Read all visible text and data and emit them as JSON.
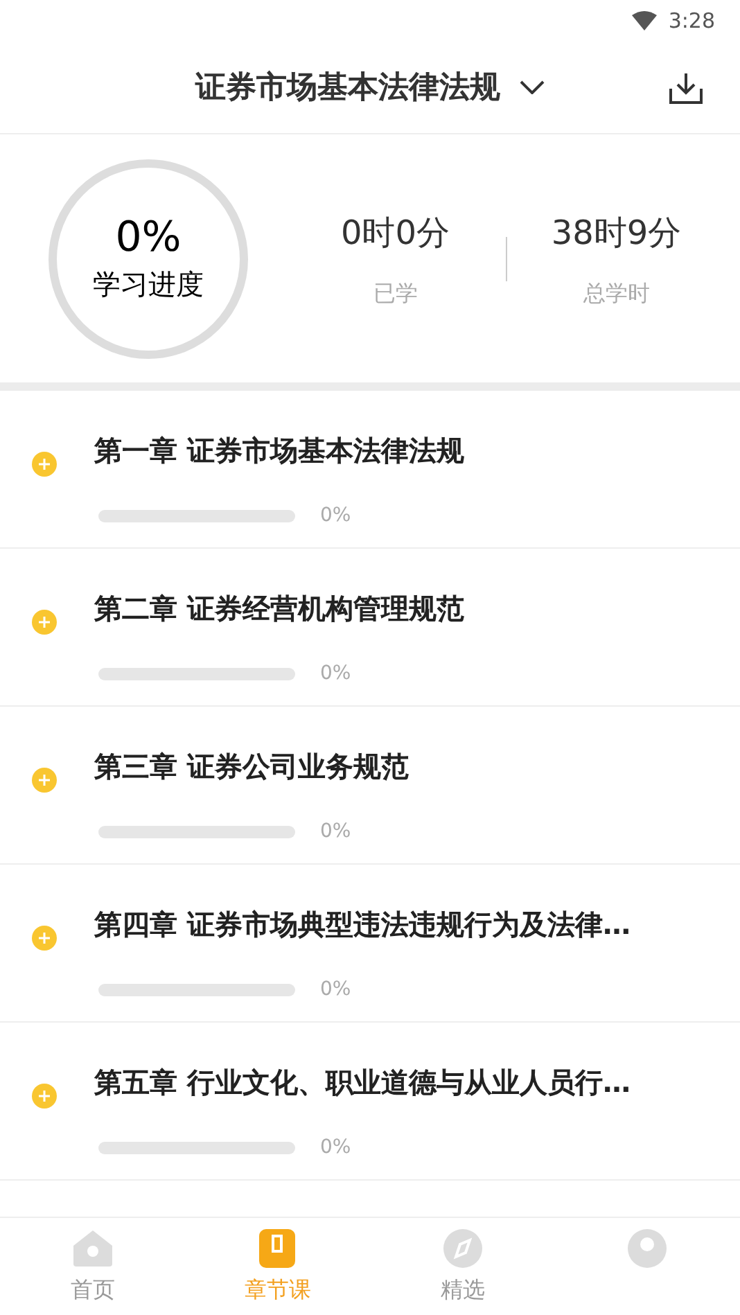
{
  "status_bar": {
    "time": "3:28"
  },
  "header": {
    "title": "证券市场基本法律法规"
  },
  "summary": {
    "progress": {
      "value": "0%",
      "label": "学习进度"
    },
    "stats": [
      {
        "value": "0时0分",
        "label": "已学"
      },
      {
        "value": "38时9分",
        "label": "总学时"
      }
    ]
  },
  "chapters": [
    {
      "title": "第一章 证券市场基本法律法规",
      "level": 0,
      "reading": "0%"
    },
    {
      "title": "第二章 证券经营机构管理规范",
      "level": 0,
      "reading": "0%"
    },
    {
      "title": "第三章 证券公司业务规范",
      "level": 0,
      "reading": "0%"
    },
    {
      "title": "第四章 证券市场典型违法违规行为及法律…",
      "level": 0,
      "reading": "0%"
    },
    {
      "title": "第五章 行业文化、职业道德与从业人员行…",
      "level": 0,
      "reading": "0%"
    }
  ],
  "tab_bar": [
    {
      "kind": "home",
      "label": "首页",
      "selected": false
    },
    {
      "kind": "book",
      "label": "章节课",
      "selected": true
    },
    {
      "kind": "compass",
      "label": "精选",
      "selected": false
    },
    {
      "kind": "profile",
      "selected": false
    }
  ]
}
